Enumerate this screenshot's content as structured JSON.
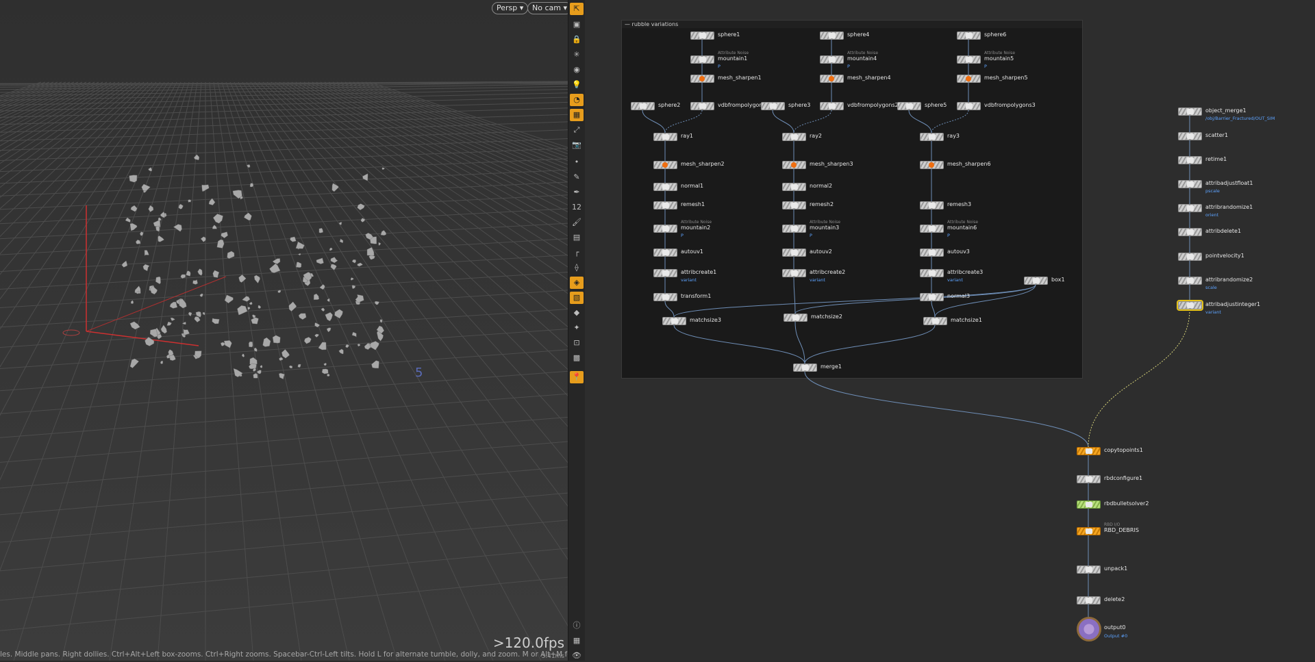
{
  "viewport": {
    "camera_menu": "Persp ▾",
    "nocam_menu": "No cam ▾",
    "fps": ">120.0fps",
    "fps_ms": "3.41ms",
    "status": "les. Middle pans. Right dollies. Ctrl+Alt+Left box-zooms. Ctrl+Right zooms. Spacebar-Ctrl-Left tilts. Hold L for alternate tumble, dolly, and zoom. M or Alt+M for First Person Navigation.",
    "grid_label": "5"
  },
  "toolbar": {
    "icons": [
      "select-icon",
      "camera-view-icon",
      "lock-icon",
      "snap-icon",
      "visibility-icon",
      "light-icon",
      "render-icon",
      "display-icon",
      "handles-icon",
      "camera-icon",
      "point-icon",
      "brush-icon",
      "pen-icon",
      "number-icon",
      "paint-icon",
      "stack-icon",
      "ruler-icon",
      "wire-icon",
      "shaded-icon",
      "frame-icon",
      "texture-icon",
      "magnet-icon",
      "display-options-icon",
      "snapshot-icon",
      "pin-icon",
      "info-icon",
      "layout-icon",
      "eye-icon"
    ]
  },
  "network": {
    "box_title": "— rubble variations",
    "nodes": [
      {
        "id": "sphere1",
        "label": "sphere1"
      },
      {
        "id": "mountain1",
        "label": "mountain1",
        "note": "Attribute Noise",
        "sub": "P"
      },
      {
        "id": "mesh_sharpen1",
        "label": "mesh_sharpen1"
      },
      {
        "id": "sphere4",
        "label": "sphere4"
      },
      {
        "id": "mountain4",
        "label": "mountain4",
        "note": "Attribute Noise",
        "sub": "P"
      },
      {
        "id": "mesh_sharpen4",
        "label": "mesh_sharpen4"
      },
      {
        "id": "sphere6",
        "label": "sphere6"
      },
      {
        "id": "mountain5",
        "label": "mountain5",
        "note": "Attribute Noise",
        "sub": "P"
      },
      {
        "id": "mesh_sharpen5",
        "label": "mesh_sharpen5"
      },
      {
        "id": "sphere2",
        "label": "sphere2"
      },
      {
        "id": "vdbfrompolygons1",
        "label": "vdbfrompolygons1"
      },
      {
        "id": "sphere3",
        "label": "sphere3"
      },
      {
        "id": "vdbfrompolygons2",
        "label": "vdbfrompolygons2"
      },
      {
        "id": "sphere5",
        "label": "sphere5"
      },
      {
        "id": "vdbfrompolygons3",
        "label": "vdbfrompolygons3"
      },
      {
        "id": "ray1",
        "label": "ray1"
      },
      {
        "id": "ray2",
        "label": "ray2"
      },
      {
        "id": "ray3",
        "label": "ray3"
      },
      {
        "id": "mesh_sharpen2",
        "label": "mesh_sharpen2"
      },
      {
        "id": "mesh_sharpen3",
        "label": "mesh_sharpen3"
      },
      {
        "id": "mesh_sharpen6",
        "label": "mesh_sharpen6"
      },
      {
        "id": "normal1",
        "label": "normal1"
      },
      {
        "id": "normal2",
        "label": "normal2"
      },
      {
        "id": "remesh1",
        "label": "remesh1"
      },
      {
        "id": "remesh2",
        "label": "remesh2"
      },
      {
        "id": "remesh3",
        "label": "remesh3"
      },
      {
        "id": "mountain2",
        "label": "mountain2",
        "note": "Attribute Noise",
        "sub": "P"
      },
      {
        "id": "mountain3",
        "label": "mountain3",
        "note": "Attribute Noise",
        "sub": "P"
      },
      {
        "id": "mountain6",
        "label": "mountain6",
        "note": "Attribute Noise",
        "sub": "P"
      },
      {
        "id": "autouv1",
        "label": "autouv1"
      },
      {
        "id": "autouv2",
        "label": "autouv2"
      },
      {
        "id": "autouv3",
        "label": "autouv3"
      },
      {
        "id": "attribcreate1",
        "label": "attribcreate1",
        "sub": "variant"
      },
      {
        "id": "attribcreate2",
        "label": "attribcreate2",
        "sub": "variant"
      },
      {
        "id": "attribcreate3",
        "label": "attribcreate3",
        "sub": "variant"
      },
      {
        "id": "box1",
        "label": "box1"
      },
      {
        "id": "transform1",
        "label": "transform1"
      },
      {
        "id": "normal3",
        "label": "normal3"
      },
      {
        "id": "matchsize3",
        "label": "matchsize3"
      },
      {
        "id": "matchsize2",
        "label": "matchsize2"
      },
      {
        "id": "matchsize1",
        "label": "matchsize1"
      },
      {
        "id": "merge1",
        "label": "merge1"
      },
      {
        "id": "object_merge1",
        "label": "object_merge1",
        "sub": "/obj/Barrier_Fractured/OUT_SIM"
      },
      {
        "id": "scatter1",
        "label": "scatter1"
      },
      {
        "id": "retime1",
        "label": "retime1"
      },
      {
        "id": "attribadjustfloat1",
        "label": "attribadjustfloat1",
        "sub": "pscale"
      },
      {
        "id": "attribrandomize1",
        "label": "attribrandomize1",
        "sub": "orient"
      },
      {
        "id": "attribdelete1",
        "label": "attribdelete1"
      },
      {
        "id": "pointvelocity1",
        "label": "pointvelocity1"
      },
      {
        "id": "attribrandomize2",
        "label": "attribrandomize2",
        "sub": "scale"
      },
      {
        "id": "attribadjustinteger1",
        "label": "attribadjustinteger1",
        "sub": "variant"
      },
      {
        "id": "copytopoints1",
        "label": "copytopoints1"
      },
      {
        "id": "rbdconfigure1",
        "label": "rbdconfigure1"
      },
      {
        "id": "rbdbulletsolver2",
        "label": "rbdbulletsolver2"
      },
      {
        "id": "RBD_DEBRIS",
        "label": "RBD_DEBRIS",
        "note": "RBD I/O"
      },
      {
        "id": "unpack1",
        "label": "unpack1"
      },
      {
        "id": "delete2",
        "label": "delete2"
      },
      {
        "id": "output0",
        "label": "output0",
        "sub": "Output #0"
      }
    ]
  }
}
